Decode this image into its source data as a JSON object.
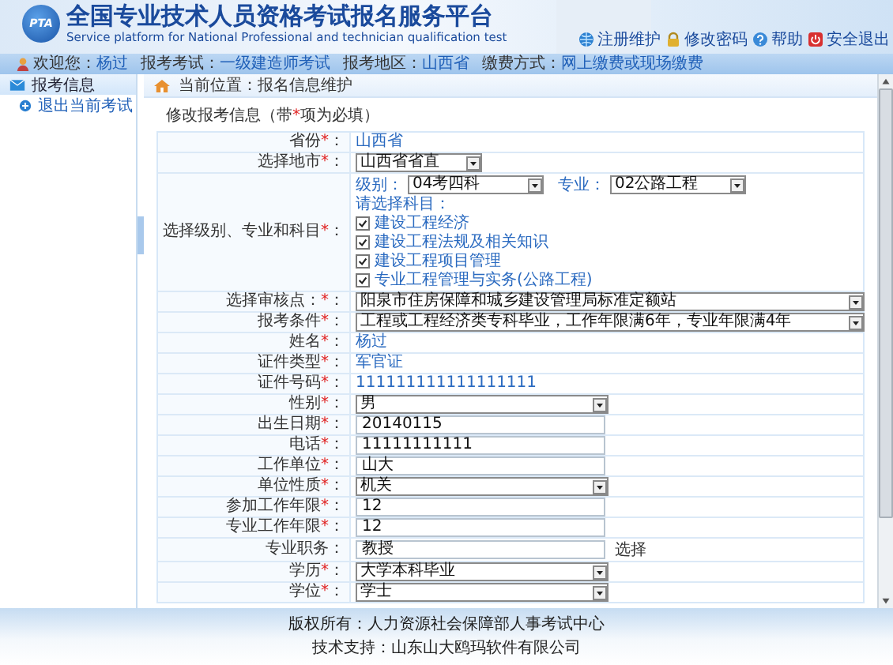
{
  "header": {
    "logo_text": "PTA",
    "title": "全国专业技术人员资格考试报名服务平台",
    "subtitle": "Service platform for National Professional and technician qualification test",
    "links": [
      {
        "label": "注册维护",
        "kind": "globe"
      },
      {
        "label": "修改密码",
        "kind": "lock"
      },
      {
        "label": "帮助",
        "kind": "help"
      },
      {
        "label": "安全退出",
        "kind": "power"
      }
    ]
  },
  "nav": [
    {
      "label": "欢迎您：",
      "value": "杨过"
    },
    {
      "label": "报考考试：",
      "value": "一级建造师考试"
    },
    {
      "label": "报考地区：",
      "value": "山西省"
    },
    {
      "label": "缴费方式：",
      "value": "网上缴费或现场缴费"
    }
  ],
  "sidebar": {
    "items": [
      {
        "label": "报考信息",
        "kind": "section"
      },
      {
        "label": "退出当前考试",
        "kind": "link"
      }
    ]
  },
  "breadcrumb": "当前位置：报名信息维护",
  "form": {
    "title_before": "修改报考信息（带",
    "title_mark": "*",
    "title_after": "项为必填）",
    "colon": "：",
    "rows": [
      {
        "label": "省份",
        "required": true,
        "kind": "text",
        "value": "山西省"
      },
      {
        "label": "选择地市",
        "required": true,
        "kind": "short_select",
        "value": "山西省省直"
      },
      {
        "label": "选择级别、专业和科目",
        "required": true,
        "kind": "subjects",
        "grade_label": "级别：",
        "grade": "04考四科",
        "major_label": "专业：",
        "major": "02公路工程",
        "prompt": "请选择科目：",
        "subjects": [
          {
            "label": "建设工程经济",
            "checked": true
          },
          {
            "label": "建设工程法规及相关知识",
            "checked": true
          },
          {
            "label": "建设工程项目管理",
            "checked": true
          },
          {
            "label": "专业工程管理与实务(公路工程)",
            "checked": true
          }
        ]
      },
      {
        "label": "选择审核点：",
        "required": true,
        "kind": "wide_select",
        "value": "阳泉市住房保障和城乡建设管理局标准定额站"
      },
      {
        "label": "报考条件 ",
        "required": true,
        "kind": "wide_select",
        "value": "工程或工程经济类专科毕业，工作年限满6年，专业年限满4年"
      },
      {
        "label": "姓名",
        "required": true,
        "kind": "text",
        "value": "杨过"
      },
      {
        "label": "证件类型",
        "required": true,
        "kind": "text",
        "value": "军官证"
      },
      {
        "label": "证件号码",
        "required": true,
        "kind": "text",
        "value": "111111111111111111"
      },
      {
        "label": "性别",
        "required": true,
        "kind": "select",
        "value": "男"
      },
      {
        "label": "出生日期",
        "required": true,
        "kind": "input",
        "value": "20140115"
      },
      {
        "label": "电话",
        "required": true,
        "kind": "input",
        "value": "11111111111"
      },
      {
        "label": "工作单位",
        "required": true,
        "kind": "input",
        "value": "山大"
      },
      {
        "label": "单位性质",
        "required": true,
        "kind": "select",
        "value": "机关"
      },
      {
        "label": "参加工作年限",
        "required": true,
        "kind": "input",
        "value": "12"
      },
      {
        "label": "专业工作年限",
        "required": true,
        "kind": "input",
        "value": "12"
      },
      {
        "label": "专业职务",
        "required": false,
        "kind": "input",
        "value": "教授",
        "extra": "选择"
      },
      {
        "label": "学历",
        "required": true,
        "kind": "select",
        "value": "大学本科毕业"
      },
      {
        "label": "学位",
        "required": true,
        "kind": "select",
        "value": "学士"
      }
    ]
  },
  "footer": [
    "版权所有：人力资源社会保障部人事考试中心",
    "技术支持：山东山大鸥玛软件有限公司"
  ]
}
